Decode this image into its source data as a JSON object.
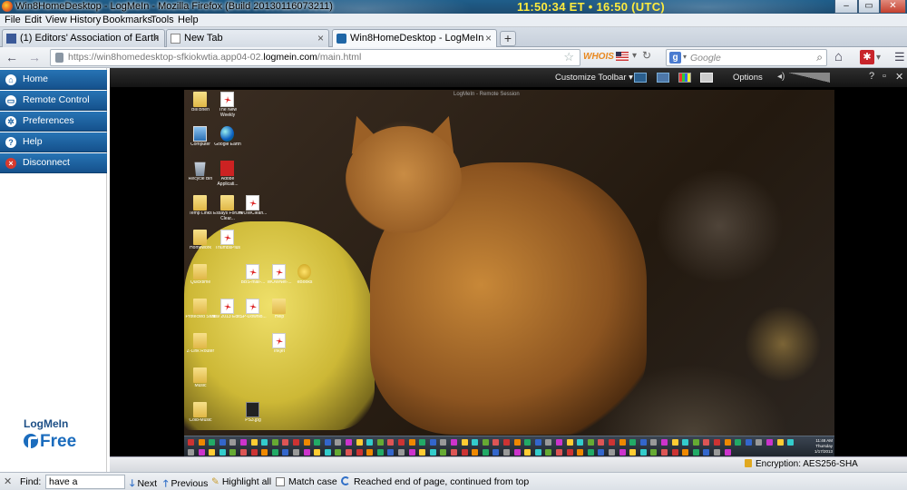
{
  "window": {
    "title": "Win8HomeDesktop - LogMeIn - Mozilla Firefox (Build 20130116073211)",
    "clock": "11:50:34 ET • 16:50 (UTC)",
    "controls": [
      "–",
      "▭",
      "✕"
    ]
  },
  "menubar": [
    "File",
    "Edit",
    "View",
    "History",
    "Bookmarks",
    "Tools",
    "Help"
  ],
  "tabs": [
    {
      "label": "(1) Editors' Association of Earth",
      "icon": "facebook-icon",
      "active": false
    },
    {
      "label": "New Tab",
      "icon": "page-icon",
      "active": false
    },
    {
      "label": "Win8HomeDesktop - LogMeIn",
      "icon": "logmein-icon",
      "active": true
    }
  ],
  "navbar": {
    "url_prefix": "https://win8homedesktop-sfkiokwtia.app04-02.",
    "url_domain": "logmein.com",
    "url_suffix": "/main.html",
    "whois": "WHOIS",
    "search_placeholder": "Google",
    "search_engine": "g"
  },
  "sidebar": {
    "items": [
      {
        "label": "Home",
        "icon": "home-icon"
      },
      {
        "label": "Remote Control",
        "icon": "remote-control-icon"
      },
      {
        "label": "Preferences",
        "icon": "gear-icon"
      },
      {
        "label": "Help",
        "icon": "help-icon"
      },
      {
        "label": "Disconnect",
        "icon": "disconnect-icon"
      }
    ],
    "brand_top": "LogMeIn",
    "brand_bottom": "Free"
  },
  "rc_toolbar": {
    "customize": "Customize Toolbar",
    "options": "Options",
    "controls": [
      "?",
      "▫",
      "✕"
    ]
  },
  "remote": {
    "session_bar": "LogMeIn - Remote Session",
    "desktop_icons": [
      {
        "label": "Bill Brien",
        "icon": "folder"
      },
      {
        "label": "The New Weekly",
        "icon": "pdf"
      },
      {
        "label": "Computer",
        "icon": "pc"
      },
      {
        "label": "Google Earth",
        "icon": "gearth"
      },
      {
        "label": "Recycle Bin",
        "icon": "recycle"
      },
      {
        "label": "Adobe Applicati...",
        "icon": "acrobat"
      },
      {
        "label": "Temp Links",
        "icon": "folder"
      },
      {
        "label": "Essays Forum Clear...",
        "icon": "folder"
      },
      {
        "label": "WOWClean...",
        "icon": "pdf"
      },
      {
        "label": "Homework",
        "icon": "folder"
      },
      {
        "label": "ThumbsPlus",
        "icon": "pdf"
      },
      {
        "label": "Quicktime",
        "icon": "folder"
      },
      {
        "label": "BBS-mail-...",
        "icon": "pdf"
      },
      {
        "label": "WOWNet-...",
        "icon": "pdf"
      },
      {
        "label": "eBooks",
        "icon": "gold"
      },
      {
        "label": "Protected Stuff",
        "icon": "folder"
      },
      {
        "label": "Nav 2013 Edit...",
        "icon": "pdf"
      },
      {
        "label": "SP-Downlo...",
        "icon": "pdf"
      },
      {
        "label": "Help",
        "icon": "folder"
      },
      {
        "label": "Z-Link Router",
        "icon": "folder"
      },
      {
        "label": "Inkjet",
        "icon": "pdf"
      },
      {
        "label": "Music",
        "icon": "folder"
      },
      {
        "label": "Cold-Music",
        "icon": "folder"
      },
      {
        "label": "PS3.jpg",
        "icon": "dark"
      }
    ],
    "tray_time": "11:48 AM",
    "tray_day": "Thursday",
    "tray_date": "1/17/2013"
  },
  "status": {
    "encryption": "Encryption: AES256-SHA"
  },
  "findbar": {
    "label": "Find:",
    "value": "have a",
    "next": "Next",
    "previous": "Previous",
    "highlight": "Highlight all",
    "match_case": "Match case",
    "status": "Reached end of page, continued from top"
  },
  "colors": {
    "sidebar": "#1f66a6",
    "clock": "#ffec3d",
    "whois": "#e8871e"
  }
}
